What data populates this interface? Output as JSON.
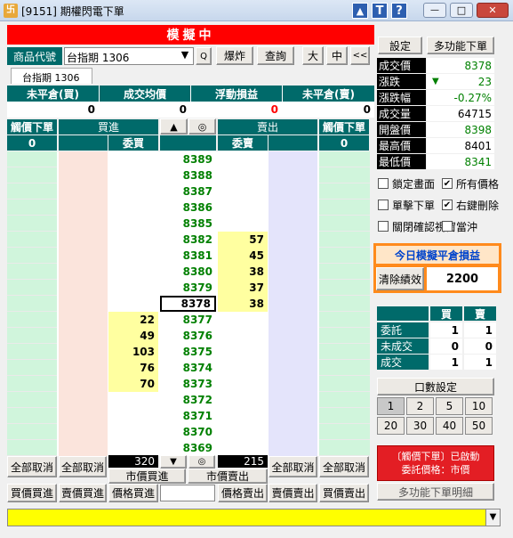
{
  "window": {
    "title": "[9151] 期權閃電下單",
    "min": "—",
    "max": "□",
    "close": "✕",
    "icon_up": "▲",
    "icon_t": "T",
    "icon_help": "?"
  },
  "banner": "模擬中",
  "product": {
    "label": "商品代號",
    "value": "台指期 1306",
    "dropdown": "▼",
    "search": "Q",
    "explode": "爆炸",
    "query": "查詢",
    "large": "大",
    "mid": "中",
    "collapse": "<<",
    "tab": "台指期  1306"
  },
  "summary": {
    "headers": [
      "未平倉(買)",
      "成交均價",
      "浮動損益",
      "未平倉(賣)"
    ],
    "values": [
      "0",
      "0",
      "0",
      "0"
    ]
  },
  "ladder_head": {
    "stop_buy": "觸價下單",
    "buy_in": "買進",
    "up": "▲",
    "center": "◎",
    "sell_out": "賣出",
    "stop_sell": "觸價下單",
    "stop_buy_count": "0",
    "bid_label": "委買",
    "ask_label": "委賣",
    "stop_sell_count": "0"
  },
  "ladder": [
    {
      "price": "8389",
      "bid": "",
      "ask": ""
    },
    {
      "price": "8388",
      "bid": "",
      "ask": ""
    },
    {
      "price": "8387",
      "bid": "",
      "ask": ""
    },
    {
      "price": "8386",
      "bid": "",
      "ask": ""
    },
    {
      "price": "8385",
      "bid": "",
      "ask": ""
    },
    {
      "price": "8382",
      "bid": "",
      "ask": "57"
    },
    {
      "price": "8381",
      "bid": "",
      "ask": "45"
    },
    {
      "price": "8380",
      "bid": "",
      "ask": "38"
    },
    {
      "price": "8379",
      "bid": "",
      "ask": "37"
    },
    {
      "price": "8378",
      "bid": "",
      "ask": "38"
    },
    {
      "price": "8377",
      "bid": "22",
      "ask": ""
    },
    {
      "price": "8376",
      "bid": "49",
      "ask": ""
    },
    {
      "price": "8375",
      "bid": "103",
      "ask": ""
    },
    {
      "price": "8374",
      "bid": "76",
      "ask": ""
    },
    {
      "price": "8373",
      "bid": "70",
      "ask": ""
    },
    {
      "price": "8372",
      "bid": "",
      "ask": ""
    },
    {
      "price": "8371",
      "bid": "",
      "ask": ""
    },
    {
      "price": "8370",
      "bid": "",
      "ask": ""
    },
    {
      "price": "8369",
      "bid": "",
      "ask": ""
    }
  ],
  "current_price_index": 9,
  "bottom": {
    "cancel_all": "全部取消",
    "bid_total": "320",
    "down": "▼",
    "center": "◎",
    "ask_total": "215",
    "market_buy": "市價買進",
    "market_sell": "市價賣出",
    "buy_buy": "買價買進",
    "sell_buy": "賣價買進",
    "price_buy": "價格買進",
    "price_sell": "價格賣出",
    "buy_sell": "賣價賣出",
    "sell_sell": "買價賣出"
  },
  "right": {
    "settings": "設定",
    "multi": "多功能下單",
    "quote": [
      {
        "label": "成交價",
        "value": "8378",
        "color": "#008000"
      },
      {
        "label": "漲跌",
        "value": "23",
        "arrow": "▼",
        "color": "#008000"
      },
      {
        "label": "漲跌幅",
        "value": "-0.27%",
        "color": "#008000"
      },
      {
        "label": "成交量",
        "value": "64715",
        "color": "#000000"
      },
      {
        "label": "開盤價",
        "value": "8398",
        "color": "#008000"
      },
      {
        "label": "最高價",
        "value": "8401",
        "color": "#000000"
      },
      {
        "label": "最低價",
        "value": "8341",
        "color": "#008000"
      }
    ],
    "checks": [
      {
        "label": "鎖定畫面",
        "checked": false
      },
      {
        "label": "所有價格",
        "checked": true
      },
      {
        "label": "單擊下單",
        "checked": false
      },
      {
        "label": "右鍵刪除",
        "checked": true
      },
      {
        "label": "關閉確認視窗",
        "checked": false
      },
      {
        "label": "當沖",
        "checked": false
      }
    ],
    "pnl_title": "今日模擬平倉損益",
    "clear": "清除績效",
    "pnl": "2200",
    "order_table": {
      "headers": [
        "",
        "買",
        "賣"
      ],
      "rows": [
        [
          "委託",
          "1",
          "1"
        ],
        [
          "未成交",
          "0",
          "0"
        ],
        [
          "成交",
          "1",
          "1"
        ]
      ]
    },
    "qty_title": "口數設定",
    "qty": [
      "1",
      "2",
      "5",
      "10",
      "20",
      "30",
      "40",
      "50"
    ],
    "stop_status": "〔觸價下單〕已啟動\n委託價格：市價",
    "multi_detail": "多功能下單明細"
  },
  "colors": {
    "teal": "#006a6a",
    "red": "#ff0000",
    "green": "#008000",
    "yellow": "#ffff00",
    "mint": "#d0f5dc",
    "pink": "#fbe4dc",
    "lav": "#e4e4fb",
    "bidbg": "#ffffa0"
  }
}
